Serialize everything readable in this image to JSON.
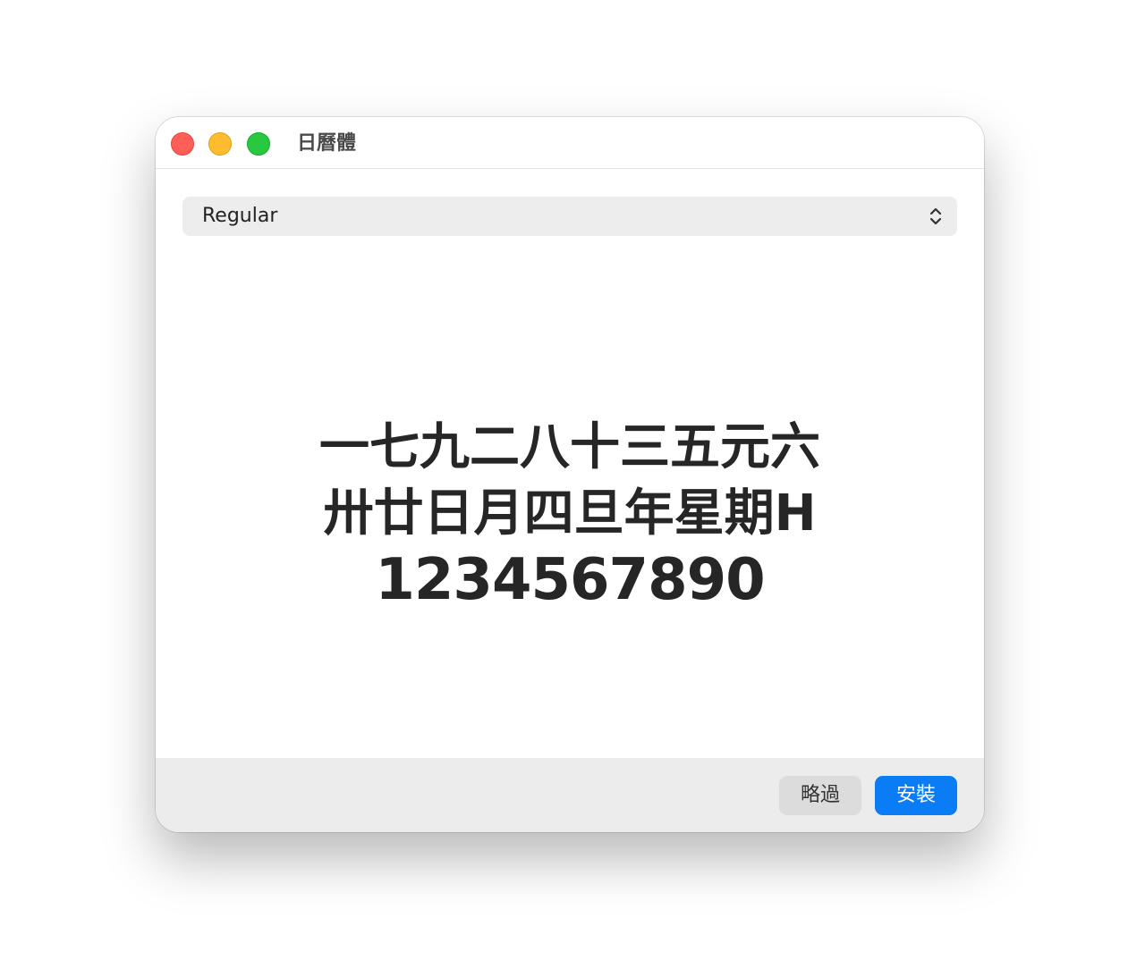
{
  "window": {
    "title": "日曆體"
  },
  "style_select": {
    "value": "Regular"
  },
  "preview": {
    "lines": [
      "一七九二八十三五元六",
      "卅廿日月四旦年星期H",
      "1234567890"
    ]
  },
  "footer": {
    "skip_label": "略過",
    "install_label": "安裝"
  },
  "colors": {
    "close": "#ff5f57",
    "minimize": "#febc2e",
    "maximize": "#28c840",
    "accent": "#0a7cf5"
  },
  "icons": {
    "select_arrows": "chevron-up-down-icon"
  }
}
